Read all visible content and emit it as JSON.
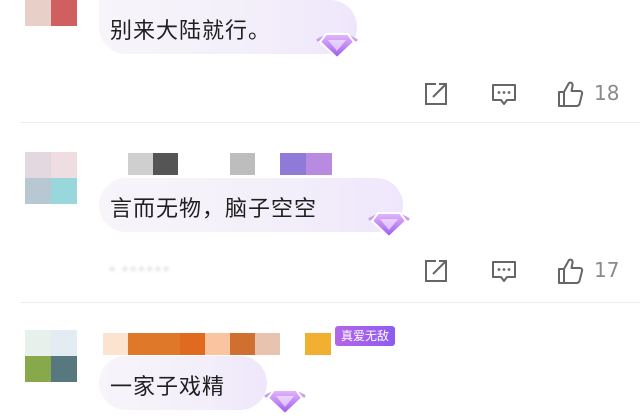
{
  "comments": [
    {
      "text": "别来大陆就行。",
      "likes": "18",
      "avatar_colors": [
        "#d4a898",
        "#c0313a",
        "#e8d0c8",
        "#d06060"
      ]
    },
    {
      "text": "言而无物，脑子空空",
      "likes": "17",
      "avatar_colors": [
        "#e3d8e0",
        "#f0dde2",
        "#b8c8d2",
        "#98d8dc"
      ],
      "name_colors": [
        "#cfcfcf",
        "#555555",
        "#bdbdbd",
        "#8f7ad8",
        "#b88ae0"
      ]
    },
    {
      "text": "一家子戏精",
      "badge": "真爱无敌",
      "avatar_colors": [
        "#e8f0ec",
        "#e2ecf2",
        "#88a84c",
        "#587880"
      ],
      "name_colors": [
        "#fbe3cf",
        "#e0782a",
        "#e06a20",
        "#fac4a0",
        "#d07030",
        "#e8c4b0",
        "#f2b030"
      ]
    }
  ],
  "icons": {
    "share": "share-external-icon",
    "reply": "comment-reply-icon",
    "like": "thumbs-up-icon",
    "gem": "diamond-gem-icon"
  },
  "accent": "#a060e0"
}
